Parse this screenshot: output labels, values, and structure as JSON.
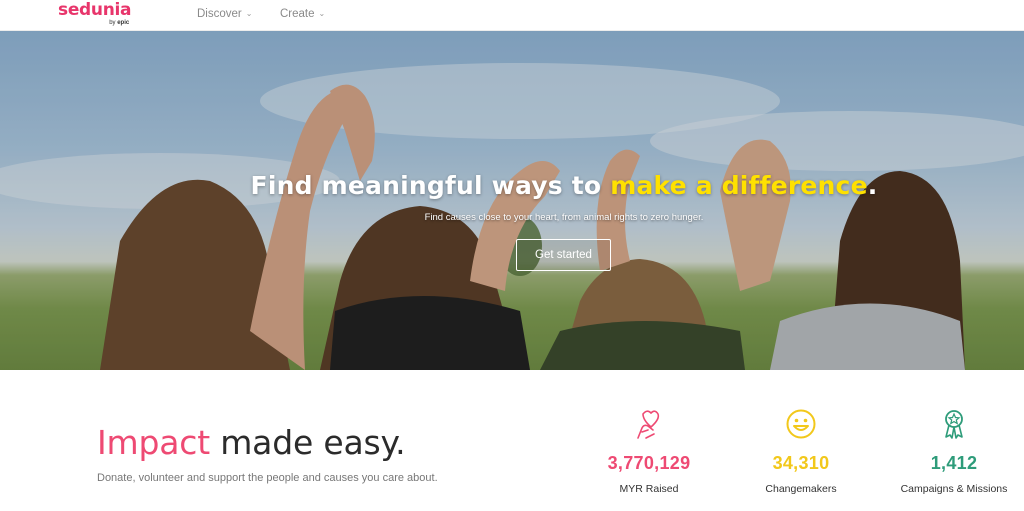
{
  "nav": {
    "logo_main": "sedunia",
    "logo_by": "by",
    "logo_brand": "epic",
    "items": [
      {
        "label": "Discover"
      },
      {
        "label": "Create"
      }
    ]
  },
  "hero": {
    "title_part1": "Find meaningful ways to ",
    "title_highlight": "make a difference",
    "title_end": ".",
    "subtitle": "Find causes close to your heart, from animal rights to zero hunger.",
    "cta_label": "Get started"
  },
  "impact": {
    "title_highlight": "Impact",
    "title_rest": " made easy.",
    "description": "Donate, volunteer and support the people and causes you care about."
  },
  "stats": [
    {
      "value": "3,770,129",
      "label": "MYR Raised",
      "color": "#ee4a73",
      "icon": "heart-hand-icon"
    },
    {
      "value": "34,310",
      "label": "Changemakers",
      "color": "#f2c81b",
      "icon": "smiley-icon"
    },
    {
      "value": "1,412",
      "label": "Campaigns & Missions",
      "color": "#2e9c7a",
      "icon": "award-badge-icon"
    }
  ],
  "colors": {
    "brand_pink": "#e8356b",
    "highlight_yellow": "#ffe100"
  }
}
